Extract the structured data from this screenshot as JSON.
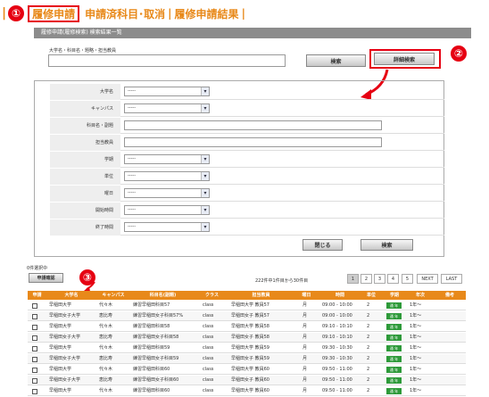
{
  "nav": {
    "bar": "|",
    "step1_number": "①",
    "active_tab": "履修申請",
    "tab2": "申請済科目･取消",
    "separator": "|",
    "tab3": "履修申請結果",
    "tab3_suffix": "|"
  },
  "panel": {
    "header": "履修申請(履修検索) 検索結果一覧"
  },
  "search": {
    "label": "大学名・科目名・題略・担当教員",
    "input_value": "",
    "search_button": "検索",
    "detail_button": "詳細検索"
  },
  "annotations": {
    "step2": "②",
    "step3": "③",
    "color": "#e60012"
  },
  "form": {
    "rows": [
      {
        "label": "大学名",
        "type": "select",
        "value": "-----"
      },
      {
        "label": "キャンパス",
        "type": "select",
        "value": "-----"
      },
      {
        "label": "科目名・副題",
        "type": "text",
        "value": ""
      },
      {
        "label": "担当教員",
        "type": "text",
        "value": ""
      },
      {
        "label": "学期",
        "type": "select",
        "value": "-----"
      },
      {
        "label": "単位",
        "type": "select",
        "value": "-----"
      },
      {
        "label": "曜日",
        "type": "select",
        "value": "-----"
      },
      {
        "label": "開始時間",
        "type": "select",
        "value": "-----"
      },
      {
        "label": "終了時間",
        "type": "select",
        "value": "-----"
      }
    ],
    "close_button": "閉じる",
    "search_button": "検索"
  },
  "results": {
    "selected_label": "0件選択中",
    "apply_button": "申請確認",
    "count_text": "222件中1件目から30件目",
    "pager": [
      "1",
      "2",
      "3",
      "4",
      "5",
      "NEXT",
      "LAST"
    ],
    "pager_active": "1",
    "columns": [
      "申請",
      "大学名",
      "キャンパス",
      "科目名(副題)",
      "クラス",
      "担当教員",
      "曜日",
      "時間",
      "単位",
      "学期",
      "年次",
      "備考"
    ],
    "rows": [
      {
        "univ": "早稲田大学",
        "campus": "代々木",
        "subject": "練習早稲田科目57",
        "class": "class",
        "teacher": "早稲田大学 教員57",
        "day": "月",
        "time": "09:00 - 10:00",
        "unit": "2",
        "term": "通 年",
        "year": "1年～"
      },
      {
        "univ": "早稲田女子大学",
        "campus": "恵比寿",
        "subject": "練習早稲田女子科目57%",
        "class": "class",
        "teacher": "早稲田女子 教員57",
        "day": "月",
        "time": "09:00 - 10:00",
        "unit": "2",
        "term": "通 年",
        "year": "1年～"
      },
      {
        "univ": "早稲田大学",
        "campus": "代々木",
        "subject": "練習早稲田科目58",
        "class": "class",
        "teacher": "早稲田大学 教員58",
        "day": "月",
        "time": "09:10 - 10:10",
        "unit": "2",
        "term": "通 年",
        "year": "1年～"
      },
      {
        "univ": "早稲田女子大学",
        "campus": "恵比寿",
        "subject": "練習早稲田女子科目58",
        "class": "class",
        "teacher": "早稲田女子 教員58",
        "day": "月",
        "time": "09:10 - 10:10",
        "unit": "2",
        "term": "通 年",
        "year": "1年～"
      },
      {
        "univ": "早稲田大学",
        "campus": "代々木",
        "subject": "練習早稲田科目59",
        "class": "class",
        "teacher": "早稲田大学 教員59",
        "day": "月",
        "time": "09:30 - 10:30",
        "unit": "2",
        "term": "通 年",
        "year": "1年～"
      },
      {
        "univ": "早稲田女子大学",
        "campus": "恵比寿",
        "subject": "練習早稲田女子科目59",
        "class": "class",
        "teacher": "早稲田女子 教員59",
        "day": "月",
        "time": "09:30 - 10:30",
        "unit": "2",
        "term": "通 年",
        "year": "1年～"
      },
      {
        "univ": "早稲田大学",
        "campus": "代々木",
        "subject": "練習早稲田科目60",
        "class": "class",
        "teacher": "早稲田大学 教員60",
        "day": "月",
        "time": "09:50 - 11:00",
        "unit": "2",
        "term": "通 年",
        "year": "1年～"
      },
      {
        "univ": "早稲田女子大学",
        "campus": "恵比寿",
        "subject": "練習早稲田女子科目60",
        "class": "class",
        "teacher": "早稲田女子 教員60",
        "day": "月",
        "time": "09:50 - 11:00",
        "unit": "2",
        "term": "通 年",
        "year": "1年～"
      },
      {
        "univ": "早稲田大学",
        "campus": "代々木",
        "subject": "練習早稲田科目60",
        "class": "class",
        "teacher": "早稲田大学 教員60",
        "day": "月",
        "time": "09:50 - 11:00",
        "unit": "2",
        "term": "通 年",
        "year": "1年～"
      }
    ]
  }
}
